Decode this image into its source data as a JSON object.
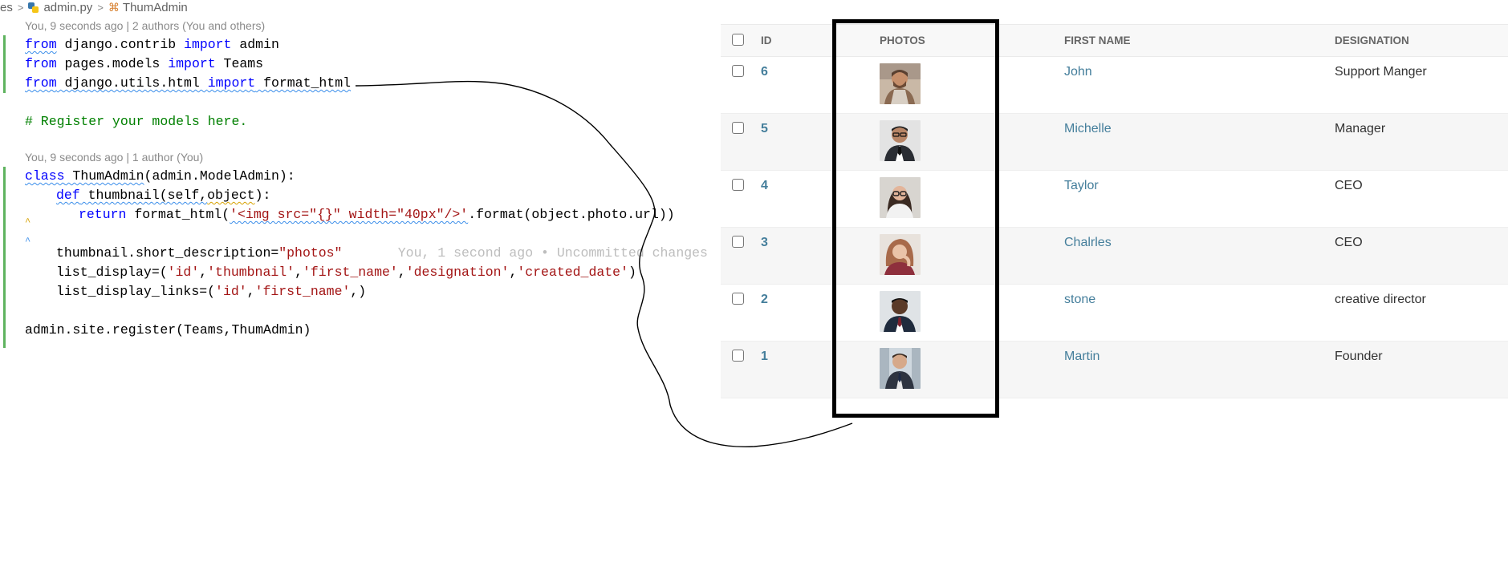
{
  "editor": {
    "breadcrumb": {
      "prefix": "es",
      "file": "admin.py",
      "symbol": "ThumAdmin"
    },
    "codelens": [
      "You, 9 seconds ago | 2 authors (You and others)",
      "You, 9 seconds ago | 1 author (You)"
    ],
    "comment": "# Register your models here.",
    "inline_blame": "You, 1 second ago • Uncommitted changes",
    "lines": {
      "l1": "from django.contrib import admin",
      "l2": "from pages.models import Teams",
      "l3": "from django.utils.html import format_html",
      "l5": "class ThumAdmin(admin.ModelAdmin):",
      "l6": "def thumbnail(self,object):",
      "l7_pre": "return format_html(",
      "l7_str": "'<img src=\"{}\" width=\"40px\"/>'",
      "l7_post": ".format(object.photo.url)",
      "l8_pre": "thumbnail.short_description=",
      "l8_str": "\"photos\"",
      "l9": "list_display=('id','thumbnail','first_name','designation','created_date')",
      "l10": "list_display_links=('id','first_name',)",
      "l11": "admin.site.register(Teams,ThumAdmin)"
    }
  },
  "admin_table": {
    "headers": {
      "id": "ID",
      "photos": "PHOTOS",
      "first_name": "FIRST NAME",
      "designation": "DESIGNATION"
    },
    "rows": [
      {
        "id": "6",
        "first_name": "John",
        "designation": "Support Manger"
      },
      {
        "id": "5",
        "first_name": "Michelle",
        "designation": "Manager"
      },
      {
        "id": "4",
        "first_name": "Taylor",
        "designation": "CEO"
      },
      {
        "id": "3",
        "first_name": "Chalrles",
        "designation": "CEO"
      },
      {
        "id": "2",
        "first_name": "stone",
        "designation": "creative director"
      },
      {
        "id": "1",
        "first_name": "Martin",
        "designation": "Founder"
      }
    ]
  },
  "colors": {
    "link": "#447e9b",
    "keyword": "#0000ff",
    "string": "#a31515",
    "comment": "#008000",
    "gutter_added": "#5fb35f"
  }
}
